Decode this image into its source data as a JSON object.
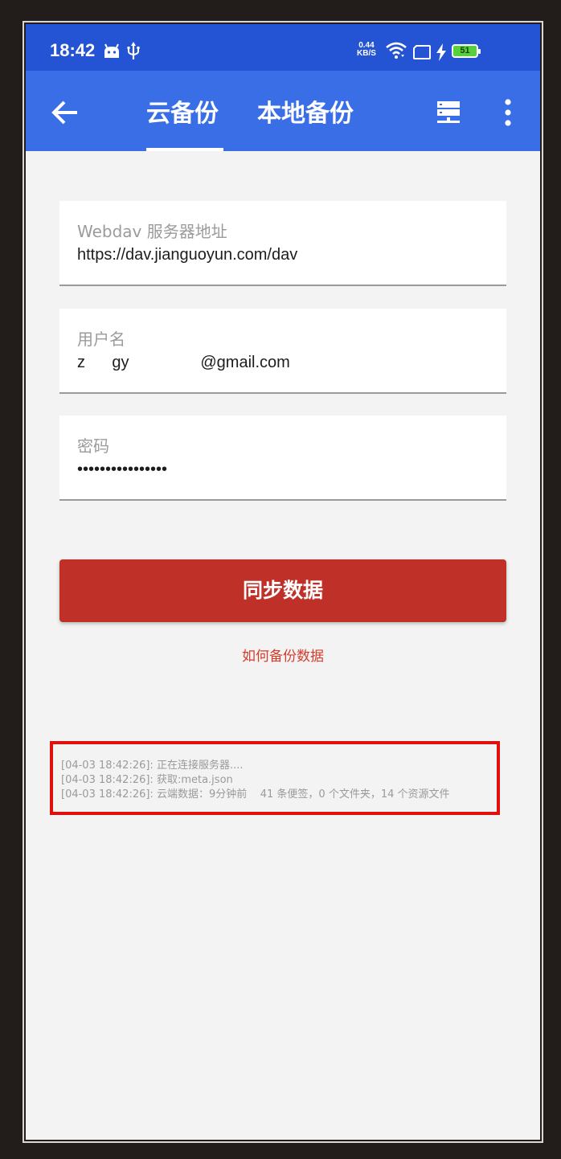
{
  "status_bar": {
    "time": "18:42",
    "speed_value": "0.44",
    "speed_unit": "KB/S",
    "battery": "51"
  },
  "app_bar": {
    "tabs": [
      {
        "label": "云备份",
        "active": true
      },
      {
        "label": "本地备份",
        "active": false
      }
    ]
  },
  "form": {
    "server": {
      "label": "Webdav 服务器地址",
      "value": "https://dav.jianguoyun.com/dav"
    },
    "username": {
      "label": "用户名",
      "value": "z      gy                @gmail.com"
    },
    "password": {
      "label": "密码",
      "value": "••••••••••••••••"
    }
  },
  "actions": {
    "sync_label": "同步数据",
    "howto_label": "如何备份数据"
  },
  "log": [
    "[04-03 18:42:26]: 正在连接服务器....",
    "[04-03 18:42:26]: 获取:meta.json",
    "[04-03 18:42:26]: 云端数据：9分钟前    41 条便签，0 个文件夹，14 个资源文件"
  ],
  "colors": {
    "status_bar": "#2453d3",
    "app_bar": "#3a6ee6",
    "primary_button": "#bf3128",
    "link": "#d43c2c",
    "highlight_border": "#e0100e"
  }
}
